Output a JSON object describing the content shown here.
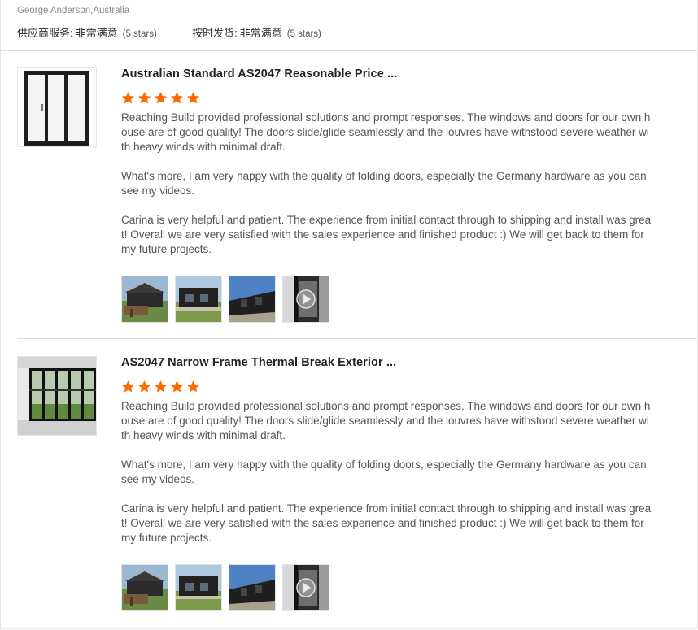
{
  "reviewer": "George Anderson,Australia",
  "ratings": [
    {
      "label": "供应商服务:",
      "value": "非常满意",
      "stars_text": "(5 stars)"
    },
    {
      "label": "按时发货:",
      "value": "非常满意",
      "stars_text": "(5 stars)"
    }
  ],
  "reviews": [
    {
      "title": "Australian Standard AS2047 Reasonable Price ...",
      "rating": 5,
      "paragraphs": [
        "Reaching Build provided professional solutions and prompt responses. The windows and doors for our own house are of good quality! The doors slide/glide seamlessly and the louvres have withstood severe weather with heavy winds with minimal draft.",
        "What's more, I am very happy with the quality of folding doors, especially the Germany hardware as you can see my videos.",
        "Carina is very helpful and patient. The experience from initial contact through to shipping and install was great!  Overall we are very satisfied with the sales experience and finished product :) We will get back to them for my future projects."
      ],
      "thumbnails": [
        "house-photo",
        "house-photo",
        "house-photo",
        "video-thumbnail"
      ]
    },
    {
      "title": "AS2047 Narrow Frame Thermal Break Exterior ...",
      "rating": 5,
      "paragraphs": [
        "Reaching Build provided professional solutions and prompt responses. The windows and doors for our own house are of good quality! The doors slide/glide seamlessly and the louvres have withstood severe weather with heavy winds with minimal draft.",
        "What's more, I am very happy with the quality of folding doors, especially the Germany hardware as you can see my videos.",
        "Carina is very helpful and patient. The experience from initial contact through to shipping and install was great!  Overall we are very satisfied with the sales experience and finished product :) We will get back to them for my future projects."
      ],
      "thumbnails": [
        "house-photo",
        "house-photo",
        "house-photo",
        "video-thumbnail"
      ]
    }
  ],
  "colors": {
    "star": "#ff6a00",
    "divider": "#dedede",
    "text": "#555555"
  }
}
